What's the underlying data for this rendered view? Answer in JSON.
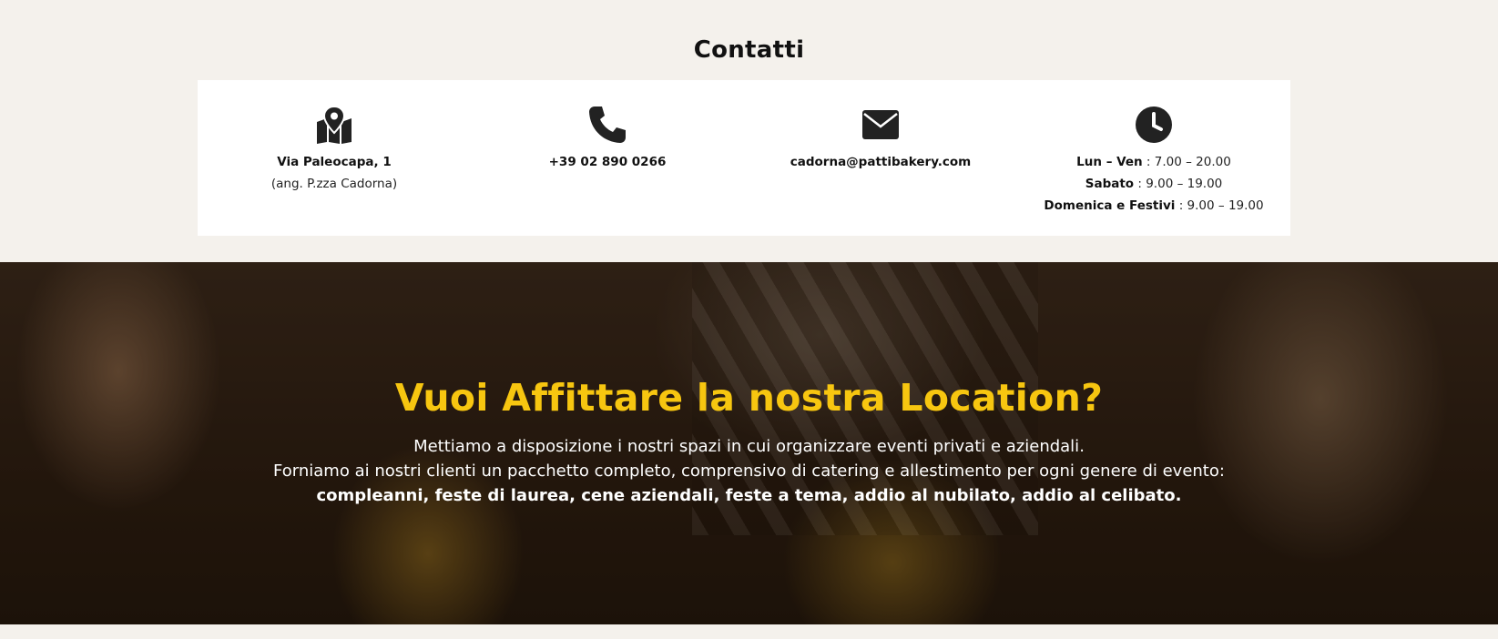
{
  "contacts": {
    "title": "Contatti",
    "address": {
      "icon": "map-pin-icon",
      "line1": "Via Paleocapa, 1",
      "line2": "(ang. P.zza Cadorna)"
    },
    "phone": {
      "icon": "phone-icon",
      "number": "+39 02 890 0266"
    },
    "email": {
      "icon": "envelope-icon",
      "address": "cadorna@pattibakery.com"
    },
    "hours": {
      "icon": "clock-icon",
      "rows": [
        {
          "label": "Lun – Ven",
          "sep": " : ",
          "value": "7.00 – 20.00"
        },
        {
          "label": "Sabato",
          "sep": " : ",
          "value": "9.00 – 19.00"
        },
        {
          "label": "Domenica e Festivi",
          "sep": " : ",
          "value": "9.00 – 19.00"
        }
      ]
    }
  },
  "location": {
    "title": "Vuoi Affittare la nostra Location?",
    "line1": "Mettiamo a disposizione i nostri spazi in cui organizzare eventi privati e aziendali.",
    "line2": "Forniamo ai nostri clienti un pacchetto completo, comprensivo di catering e allestimento per ogni genere di evento:",
    "line3": "compleanni, feste di laurea, cene aziendali, feste a tema, addio al nubilato, addio al celibato."
  },
  "colors": {
    "accent": "#f7c610",
    "background": "#f4f1ec",
    "card": "#ffffff",
    "icon": "#222222"
  }
}
